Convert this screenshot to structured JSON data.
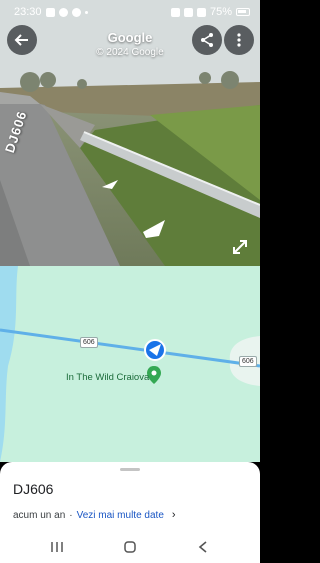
{
  "status_bar": {
    "time": "23:30",
    "battery": "75%"
  },
  "header": {
    "title": "Google",
    "subtitle": "© 2024 Google"
  },
  "streetview": {
    "road_label": "DJ606"
  },
  "map": {
    "poi_name": "In The Wild Craiova",
    "road_shield_1": "606",
    "road_shield_2": "606",
    "colors": {
      "land": "#c7f0dd",
      "water": "#9fdcef",
      "road": "#5fb0e8",
      "poi": "#34a853",
      "heading": "#1a73e8"
    }
  },
  "sheet": {
    "title": "DJ606",
    "time_ago": "acum un an",
    "separator": "·",
    "more_data": "Vezi mai multe date",
    "chevron": "›"
  }
}
